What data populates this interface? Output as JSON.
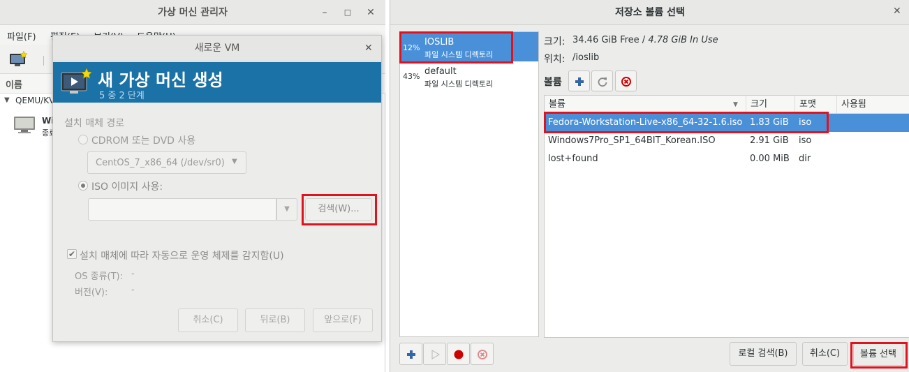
{
  "manager": {
    "title": "가상 머신 관리자",
    "menus": [
      "파일(F)",
      "편집(E)",
      "보기(V)",
      "도움말(H)"
    ],
    "column_name": "이름",
    "connection": "QEMU/KVM",
    "vm_name": "Wi",
    "vm_state": "종료"
  },
  "wizard": {
    "window_title": "새로운 VM",
    "heading": "새 가상 머신 생성",
    "step": "5 중 2 단계",
    "section_label": "설치 매체 경로",
    "cdrom_label": "CDROM 또는 DVD 사용",
    "cdrom_device": "CentOS_7_x86_64 (/dev/sr0)",
    "iso_label": "ISO 이미지 사용:",
    "iso_value": "",
    "browse_label": "검색(W)...",
    "autodetect_label": "설치 매체에 따라 자동으로 운영 체제를 감지함(U)",
    "os_type_label": "OS 종류(T):",
    "os_type_value": "-",
    "version_label": "버전(V):",
    "version_value": "-",
    "cancel_label": "취소(C)",
    "back_label": "뒤로(B)",
    "forward_label": "앞으로(F)"
  },
  "storage": {
    "title": "저장소 볼륨 선택",
    "pools": [
      {
        "usage": "12%",
        "name": "IOSLIB",
        "type": "파일 시스템 디렉토리",
        "selected": true
      },
      {
        "usage": "43%",
        "name": "default",
        "type": "파일 시스템 디렉토리",
        "selected": false
      }
    ],
    "size_label": "크기:",
    "size_free": "34.46 GiB Free",
    "size_sep": " / ",
    "size_used": "4.78 GiB In Use",
    "location_label": "위치:",
    "location_value": "/ioslib",
    "volumes_label": "볼륨",
    "columns": [
      "볼륨",
      "크기",
      "포맷",
      "사용됨"
    ],
    "volumes": [
      {
        "name": "Fedora-Workstation-Live-x86_64-32-1.6.iso",
        "size": "1.83 GiB",
        "format": "iso",
        "used": "",
        "selected": true
      },
      {
        "name": "Windows7Pro_SP1_64BIT_Korean.ISO",
        "size": "2.91 GiB",
        "format": "iso",
        "used": "",
        "selected": false
      },
      {
        "name": "lost+found",
        "size": "0.00 MiB",
        "format": "dir",
        "used": "",
        "selected": false
      }
    ],
    "local_browse_label": "로컬 검색(B)",
    "cancel_label": "취소(C)",
    "choose_label": "볼륨 선택"
  },
  "colors": {
    "selection": "#4a90d9",
    "banner": "#1a72a7",
    "highlight_box": "#e0121d"
  }
}
